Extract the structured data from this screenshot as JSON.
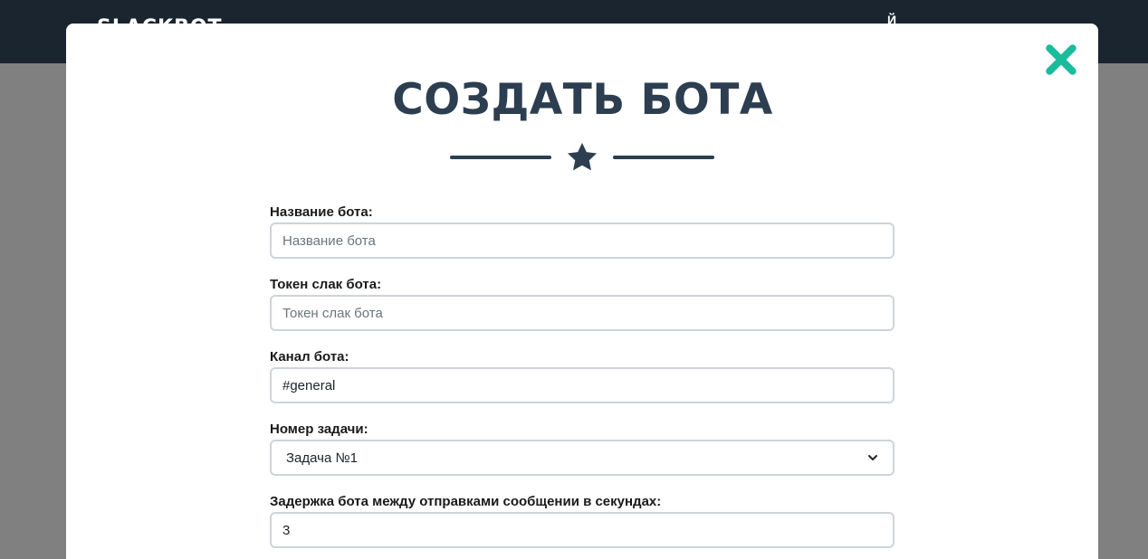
{
  "topbar": {
    "logo": "SLACKBOT",
    "nav_item": "Й"
  },
  "modal": {
    "title": "СОЗДАТЬ БОТА",
    "close_icon": "close-x-icon",
    "divider_icon": "star-icon",
    "accent_color": "#1abc9c",
    "title_color": "#2c3e50"
  },
  "form": {
    "bot_name": {
      "label": "Название бота:",
      "value": "",
      "placeholder": "Название бота"
    },
    "slack_token": {
      "label": "Токен слак бота:",
      "value": "",
      "placeholder": "Токен слак бота"
    },
    "channel": {
      "label": "Канал бота:",
      "value": "#general",
      "placeholder": ""
    },
    "task_number": {
      "label": "Номер задачи:",
      "selected": "Задача №1"
    },
    "delay": {
      "label": "Задержка бота между отправками сообщении в секундах:",
      "value": "3",
      "placeholder": ""
    }
  }
}
